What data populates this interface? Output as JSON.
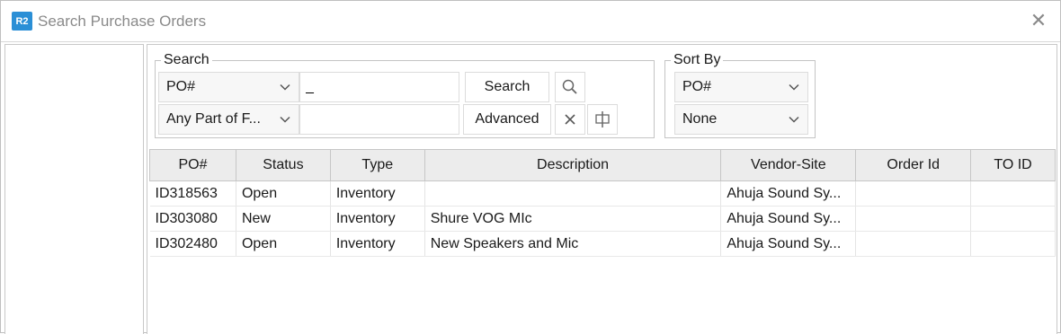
{
  "window": {
    "logo_text": "R2",
    "title": "Search Purchase Orders",
    "close_glyph": "✕"
  },
  "search": {
    "legend": "Search",
    "field_select": "PO#",
    "match_select": "Any Part of F...",
    "query_value": "_",
    "advanced_value": "",
    "search_label": "Search",
    "advanced_label": "Advanced"
  },
  "sort": {
    "legend": "Sort By",
    "primary": "PO#",
    "secondary": "None"
  },
  "table": {
    "columns": [
      "PO#",
      "Status",
      "Type",
      "Description",
      "Vendor-Site",
      "Order Id",
      "TO ID"
    ],
    "rows": [
      [
        "ID318563",
        "Open",
        "Inventory",
        "",
        "Ahuja Sound Sy...",
        "",
        ""
      ],
      [
        "ID303080",
        "New",
        "Inventory",
        "Shure VOG MIc",
        "Ahuja Sound Sy...",
        "",
        ""
      ],
      [
        "ID302480",
        "Open",
        "Inventory",
        "New Speakers and Mic",
        "Ahuja Sound Sy...",
        "",
        ""
      ]
    ]
  },
  "icons": {
    "logo": "app-logo-icon",
    "close": "close-icon",
    "dropdown": "chevron-down-icon",
    "search": "magnifier-icon",
    "clear": "clear-x-icon",
    "columns": "column-chooser-icon"
  },
  "colors": {
    "logo": "#2b8fd6",
    "header_bg": "#ececec"
  }
}
